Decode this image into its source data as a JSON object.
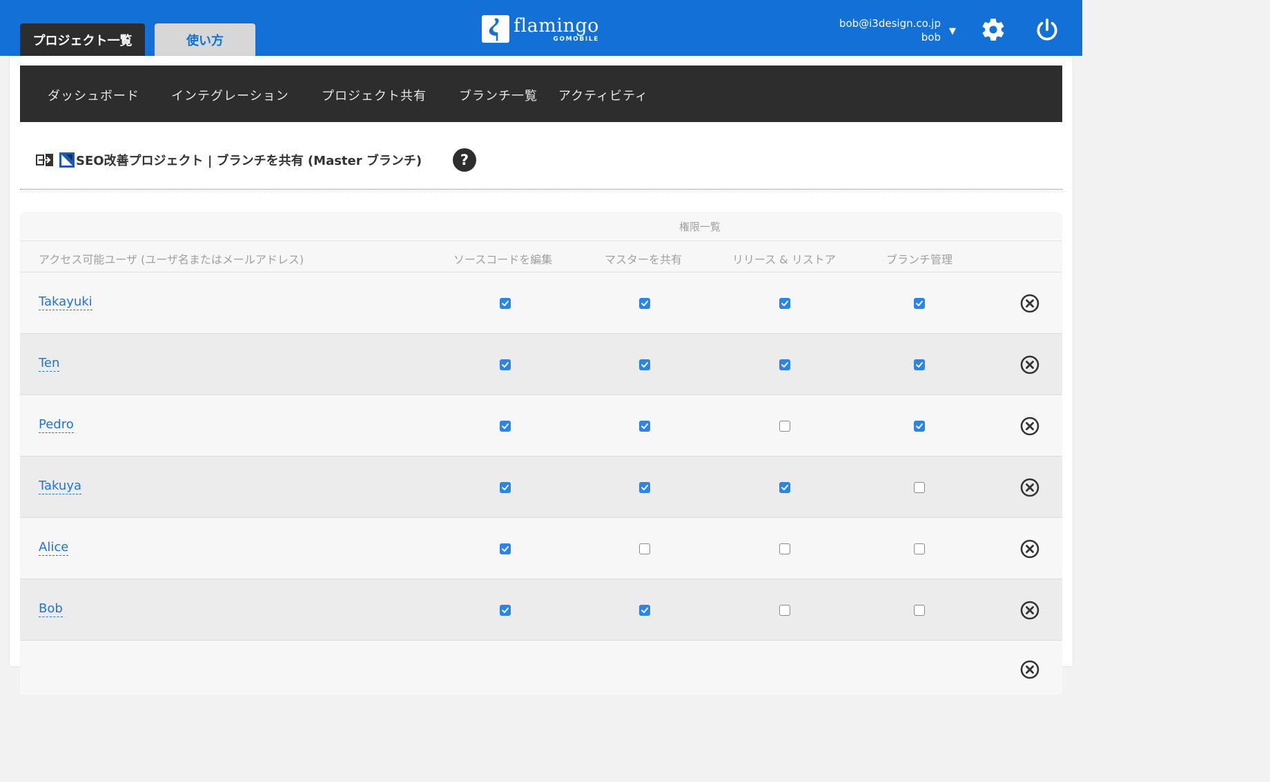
{
  "header": {
    "tabs": [
      {
        "label": "プロジェクト一覧",
        "active": true
      },
      {
        "label": "使い方",
        "active": false
      }
    ],
    "logo": {
      "name": "flamingo",
      "sub": "GOMOBILE"
    },
    "user": {
      "email": "bob@i3design.co.jp",
      "name": "bob"
    },
    "icons": [
      "chevron-down-icon",
      "gear-icon",
      "power-icon"
    ]
  },
  "nav": {
    "items": [
      "ダッシュボード",
      "インテグレーション",
      "プロジェクト共有",
      "ブランチ一覧",
      "アクティビティ"
    ]
  },
  "page": {
    "title": "SEO改善プロジェクト | ブランチを共有 (Master ブランチ)",
    "help": "?"
  },
  "table": {
    "group_label": "権限一覧",
    "columns": [
      "アクセス可能ユーザ (ユーザ名またはメールアドレス)",
      "ソースコードを編集",
      "マスターを共有",
      "リリース & リストア",
      "ブランチ管理"
    ],
    "rows": [
      {
        "user": "Takayuki",
        "perms": [
          true,
          true,
          true,
          true
        ]
      },
      {
        "user": "Ten",
        "perms": [
          true,
          true,
          true,
          true
        ]
      },
      {
        "user": "Pedro",
        "perms": [
          true,
          true,
          false,
          true
        ]
      },
      {
        "user": "Takuya",
        "perms": [
          true,
          true,
          true,
          false
        ]
      },
      {
        "user": "Alice",
        "perms": [
          true,
          false,
          false,
          false
        ]
      },
      {
        "user": "Bob",
        "perms": [
          true,
          true,
          false,
          false
        ]
      },
      {
        "user": "",
        "perms": []
      }
    ]
  },
  "colors": {
    "header_blue": "#1370d6",
    "dark": "#2d2d2d",
    "link": "#1e74d6",
    "checkbox_on": "#2c84e6"
  }
}
